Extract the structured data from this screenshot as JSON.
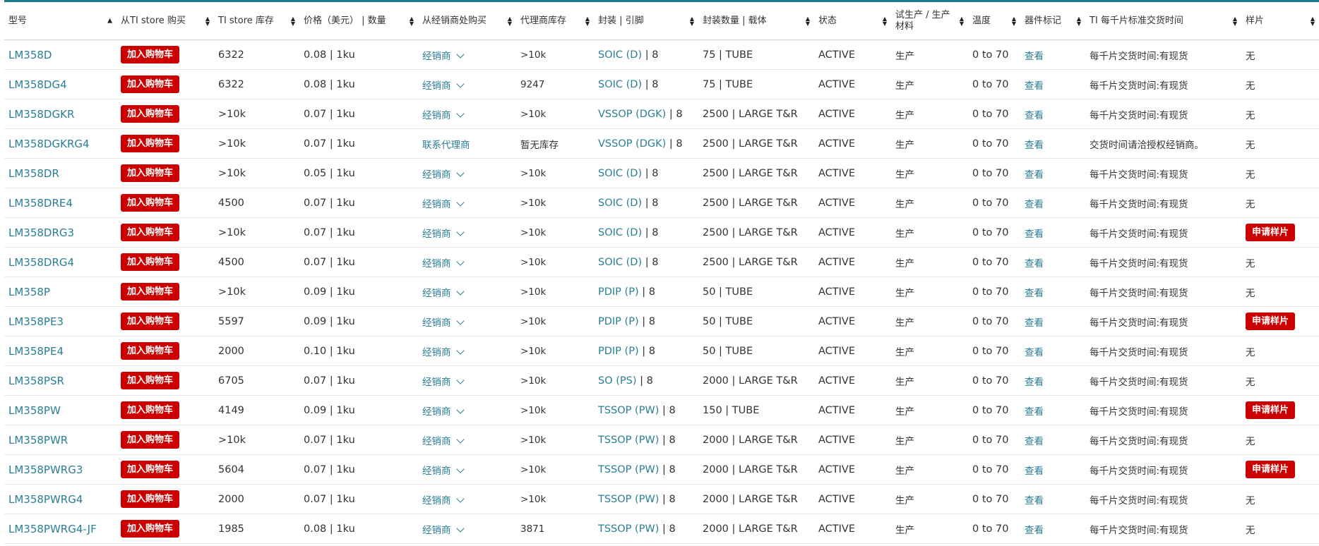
{
  "headers": [
    "型号",
    "从TI store 购买",
    "TI store 库存",
    "价格（美元） | 数量",
    "从经销商处购买",
    "代理商库存",
    "封装 | 引脚",
    "封装数量 | 载体",
    "状态",
    "试生产 / 生产材料",
    "温度",
    "器件标记",
    "TI 每千片标准交货时间",
    "样片"
  ],
  "cart_label": "加入购物车",
  "rows": [
    {
      "part": "LM358D",
      "stock": "6322",
      "price": "0.08 | 1ku",
      "dist": "经销商",
      "dist_dropdown": true,
      "dist_stock": ">10k",
      "pkg": "SOIC (D)",
      "pins": " | 8",
      "qty": "75 | TUBE",
      "status": "ACTIVE",
      "material": "生产",
      "temp": "0 to 70",
      "marking": "查看",
      "lead": "每千片交货时间:有现货",
      "sample": "无",
      "sample_button": false
    },
    {
      "part": "LM358DG4",
      "stock": "6322",
      "price": "0.08 | 1ku",
      "dist": "经销商",
      "dist_dropdown": true,
      "dist_stock": "9247",
      "pkg": "SOIC (D)",
      "pins": " | 8",
      "qty": "75 | TUBE",
      "status": "ACTIVE",
      "material": "生产",
      "temp": "0 to 70",
      "marking": "查看",
      "lead": "每千片交货时间:有现货",
      "sample": "无",
      "sample_button": false
    },
    {
      "part": "LM358DGKR",
      "stock": ">10k",
      "price": "0.07 | 1ku",
      "dist": "经销商",
      "dist_dropdown": true,
      "dist_stock": ">10k",
      "pkg": "VSSOP (DGK)",
      "pins": " | 8",
      "qty": "2500 | LARGE T&R",
      "status": "ACTIVE",
      "material": "生产",
      "temp": "0 to 70",
      "marking": "查看",
      "lead": "每千片交货时间:有现货",
      "sample": "无",
      "sample_button": false
    },
    {
      "part": "LM358DGKRG4",
      "stock": ">10k",
      "price": "0.07 | 1ku",
      "dist": "联系代理商",
      "dist_dropdown": false,
      "dist_stock": "暂无库存",
      "pkg": "VSSOP (DGK)",
      "pins": " | 8",
      "qty": "2500 | LARGE T&R",
      "status": "ACTIVE",
      "material": "生产",
      "temp": "0 to 70",
      "marking": "查看",
      "lead": "交货时间请洽授权经销商。",
      "sample": "无",
      "sample_button": false
    },
    {
      "part": "LM358DR",
      "stock": ">10k",
      "price": "0.05 | 1ku",
      "dist": "经销商",
      "dist_dropdown": true,
      "dist_stock": ">10k",
      "pkg": "SOIC (D)",
      "pins": " | 8",
      "qty": "2500 | LARGE T&R",
      "status": "ACTIVE",
      "material": "生产",
      "temp": "0 to 70",
      "marking": "查看",
      "lead": "每千片交货时间:有现货",
      "sample": "无",
      "sample_button": false
    },
    {
      "part": "LM358DRE4",
      "stock": "4500",
      "price": "0.07 | 1ku",
      "dist": "经销商",
      "dist_dropdown": true,
      "dist_stock": ">10k",
      "pkg": "SOIC (D)",
      "pins": " | 8",
      "qty": "2500 | LARGE T&R",
      "status": "ACTIVE",
      "material": "生产",
      "temp": "0 to 70",
      "marking": "查看",
      "lead": "每千片交货时间:有现货",
      "sample": "无",
      "sample_button": false
    },
    {
      "part": "LM358DRG3",
      "stock": ">10k",
      "price": "0.07 | 1ku",
      "dist": "经销商",
      "dist_dropdown": true,
      "dist_stock": ">10k",
      "pkg": "SOIC (D)",
      "pins": " | 8",
      "qty": "2500 | LARGE T&R",
      "status": "ACTIVE",
      "material": "生产",
      "temp": "0 to 70",
      "marking": "查看",
      "lead": "每千片交货时间:有现货",
      "sample": "申请样片",
      "sample_button": true
    },
    {
      "part": "LM358DRG4",
      "stock": "4500",
      "price": "0.07 | 1ku",
      "dist": "经销商",
      "dist_dropdown": true,
      "dist_stock": ">10k",
      "pkg": "SOIC (D)",
      "pins": " | 8",
      "qty": "2500 | LARGE T&R",
      "status": "ACTIVE",
      "material": "生产",
      "temp": "0 to 70",
      "marking": "查看",
      "lead": "每千片交货时间:有现货",
      "sample": "无",
      "sample_button": false
    },
    {
      "part": "LM358P",
      "stock": ">10k",
      "price": "0.09 | 1ku",
      "dist": "经销商",
      "dist_dropdown": true,
      "dist_stock": ">10k",
      "pkg": "PDIP (P)",
      "pins": " | 8",
      "qty": "50 | TUBE",
      "status": "ACTIVE",
      "material": "生产",
      "temp": "0 to 70",
      "marking": "查看",
      "lead": "每千片交货时间:有现货",
      "sample": "无",
      "sample_button": false
    },
    {
      "part": "LM358PE3",
      "stock": "5597",
      "price": "0.09 | 1ku",
      "dist": "经销商",
      "dist_dropdown": true,
      "dist_stock": ">10k",
      "pkg": "PDIP (P)",
      "pins": " | 8",
      "qty": "50 | TUBE",
      "status": "ACTIVE",
      "material": "生产",
      "temp": "0 to 70",
      "marking": "查看",
      "lead": "每千片交货时间:有现货",
      "sample": "申请样片",
      "sample_button": true
    },
    {
      "part": "LM358PE4",
      "stock": "2000",
      "price": "0.10 | 1ku",
      "dist": "经销商",
      "dist_dropdown": true,
      "dist_stock": ">10k",
      "pkg": "PDIP (P)",
      "pins": " | 8",
      "qty": "50 | TUBE",
      "status": "ACTIVE",
      "material": "生产",
      "temp": "0 to 70",
      "marking": "查看",
      "lead": "每千片交货时间:有现货",
      "sample": "无",
      "sample_button": false
    },
    {
      "part": "LM358PSR",
      "stock": "6705",
      "price": "0.07 | 1ku",
      "dist": "经销商",
      "dist_dropdown": true,
      "dist_stock": ">10k",
      "pkg": "SO (PS)",
      "pins": " | 8",
      "qty": "2000 | LARGE T&R",
      "status": "ACTIVE",
      "material": "生产",
      "temp": "0 to 70",
      "marking": "查看",
      "lead": "每千片交货时间:有现货",
      "sample": "无",
      "sample_button": false
    },
    {
      "part": "LM358PW",
      "stock": "4149",
      "price": "0.09 | 1ku",
      "dist": "经销商",
      "dist_dropdown": true,
      "dist_stock": ">10k",
      "pkg": "TSSOP (PW)",
      "pins": " | 8",
      "qty": "150 | TUBE",
      "status": "ACTIVE",
      "material": "生产",
      "temp": "0 to 70",
      "marking": "查看",
      "lead": "每千片交货时间:有现货",
      "sample": "申请样片",
      "sample_button": true
    },
    {
      "part": "LM358PWR",
      "stock": ">10k",
      "price": "0.07 | 1ku",
      "dist": "经销商",
      "dist_dropdown": true,
      "dist_stock": ">10k",
      "pkg": "TSSOP (PW)",
      "pins": " | 8",
      "qty": "2000 | LARGE T&R",
      "status": "ACTIVE",
      "material": "生产",
      "temp": "0 to 70",
      "marking": "查看",
      "lead": "每千片交货时间:有现货",
      "sample": "无",
      "sample_button": false
    },
    {
      "part": "LM358PWRG3",
      "stock": "5604",
      "price": "0.07 | 1ku",
      "dist": "经销商",
      "dist_dropdown": true,
      "dist_stock": ">10k",
      "pkg": "TSSOP (PW)",
      "pins": " | 8",
      "qty": "2000 | LARGE T&R",
      "status": "ACTIVE",
      "material": "生产",
      "temp": "0 to 70",
      "marking": "查看",
      "lead": "每千片交货时间:有现货",
      "sample": "申请样片",
      "sample_button": true
    },
    {
      "part": "LM358PWRG4",
      "stock": "2000",
      "price": "0.07 | 1ku",
      "dist": "经销商",
      "dist_dropdown": true,
      "dist_stock": ">10k",
      "pkg": "TSSOP (PW)",
      "pins": " | 8",
      "qty": "2000 | LARGE T&R",
      "status": "ACTIVE",
      "material": "生产",
      "temp": "0 to 70",
      "marking": "查看",
      "lead": "每千片交货时间:有现货",
      "sample": "无",
      "sample_button": false
    },
    {
      "part": "LM358PWRG4-JF",
      "stock": "1985",
      "price": "0.08 | 1ku",
      "dist": "经销商",
      "dist_dropdown": true,
      "dist_stock": "3871",
      "pkg": "TSSOP (PW)",
      "pins": " | 8",
      "qty": "2000 | LARGE T&R",
      "status": "ACTIVE",
      "material": "生产",
      "temp": "0 to 70",
      "marking": "查看",
      "lead": "每千片交货时间:有现货",
      "sample": "无",
      "sample_button": false
    }
  ],
  "colors": {
    "link": "#2a7f96",
    "button": "#cc0000",
    "topline": "#1b7a8c"
  }
}
